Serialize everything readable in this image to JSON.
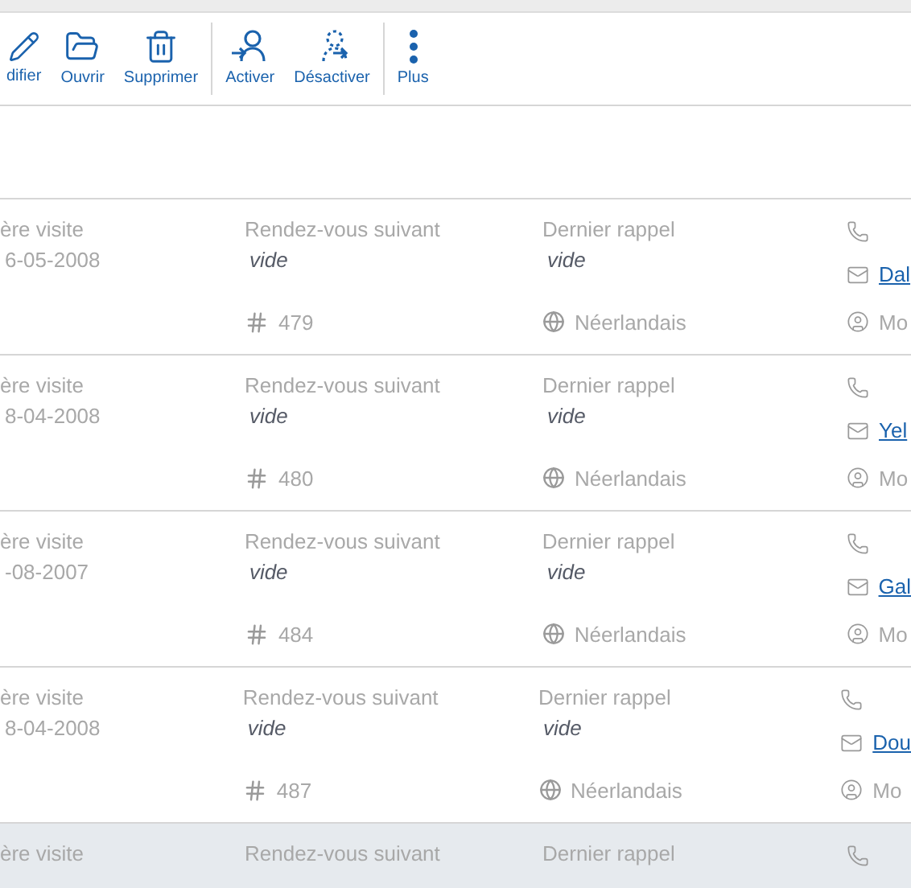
{
  "toolbar": {
    "groups": [
      [
        {
          "kind": "edit",
          "label": "difier"
        },
        {
          "kind": "open",
          "label": "Ouvrir"
        },
        {
          "kind": "delete",
          "label": "Supprimer"
        }
      ],
      [
        {
          "kind": "activate",
          "label": "Activer"
        },
        {
          "kind": "deactivate",
          "label": "Désactiver"
        }
      ],
      [
        {
          "kind": "more",
          "label": "Plus"
        }
      ]
    ]
  },
  "rows": [
    {
      "selected": false,
      "visit_label": "ère visite",
      "visit_date": "6-05-2008",
      "next_label": "Rendez-vous suivant",
      "next_value": "vide",
      "next_empty": true,
      "reminder_label": "Dernier rappel",
      "reminder_value": "vide",
      "reminder_empty": true,
      "number": "479",
      "language": "Néerlandais",
      "email": "Dal",
      "owner": "Mo"
    },
    {
      "selected": false,
      "visit_label": "ère visite",
      "visit_date": "8-04-2008",
      "next_label": "Rendez-vous suivant",
      "next_value": "vide",
      "next_empty": true,
      "reminder_label": "Dernier rappel",
      "reminder_value": "vide",
      "reminder_empty": true,
      "number": "480",
      "language": "Néerlandais",
      "email": "Yel",
      "owner": "Mo"
    },
    {
      "selected": false,
      "visit_label": "ère visite",
      "visit_date": "-08-2007",
      "next_label": "Rendez-vous suivant",
      "next_value": "vide",
      "next_empty": true,
      "reminder_label": "Dernier rappel",
      "reminder_value": "vide",
      "reminder_empty": true,
      "number": "484",
      "language": "Néerlandais",
      "email": "Gal",
      "owner": "Mo"
    },
    {
      "selected": false,
      "visit_label": "ère visite",
      "visit_date": "8-04-2008",
      "next_label": "Rendez-vous suivant",
      "next_value": "vide",
      "next_empty": true,
      "reminder_label": "Dernier rappel",
      "reminder_value": "vide",
      "reminder_empty": true,
      "number": "487",
      "language": "Néerlandais",
      "email": "Dou",
      "owner": "Mo"
    },
    {
      "selected": true,
      "visit_label": "ère visite",
      "next_label": "Rendez-vous suivant",
      "reminder_label": "Dernier rappel"
    }
  ]
}
